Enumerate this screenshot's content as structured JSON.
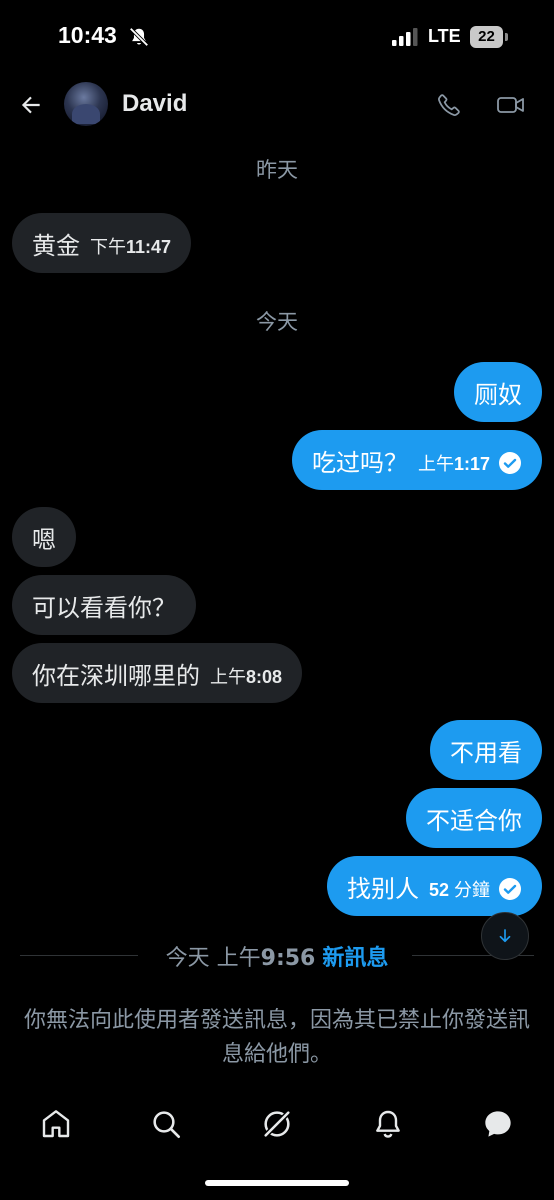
{
  "status_bar": {
    "time": "10:43",
    "network": "LTE",
    "battery": "22"
  },
  "header": {
    "contact_name": "David"
  },
  "date_separators": {
    "yesterday": "昨天",
    "today": "今天"
  },
  "messages": [
    {
      "direction": "incoming",
      "text": "黄金",
      "time_prefix": "下午",
      "time": "11:47"
    },
    {
      "direction": "outgoing",
      "text": "厕奴"
    },
    {
      "direction": "outgoing",
      "text": "吃过吗？",
      "time_prefix": "上午",
      "time": "1:17",
      "read": true
    },
    {
      "direction": "incoming",
      "text": "嗯"
    },
    {
      "direction": "incoming",
      "text": "可以看看你？"
    },
    {
      "direction": "incoming",
      "text": "你在深圳哪里的",
      "time_prefix": "上午",
      "time": "8:08"
    },
    {
      "direction": "outgoing",
      "text": "不用看"
    },
    {
      "direction": "outgoing",
      "text": "不适合你"
    },
    {
      "direction": "outgoing",
      "text": "找别人",
      "time_prefix": "52",
      "time": "分鐘",
      "read": true
    }
  ],
  "new_messages_separator": {
    "day": "今天",
    "time_prefix": "上午",
    "time": "9:56",
    "label": "新訊息"
  },
  "blocked_notice": "你無法向此使用者發送訊息，因為其已禁止你發送訊息給他們。",
  "colors": {
    "background": "#000000",
    "incoming_bubble": "#202327",
    "outgoing_bubble": "#1d9bf0",
    "secondary_text": "#8b98a5",
    "accent": "#1d9bf0"
  },
  "nav": [
    "home-icon",
    "search-icon",
    "grok-icon",
    "notifications-icon",
    "messages-icon"
  ]
}
